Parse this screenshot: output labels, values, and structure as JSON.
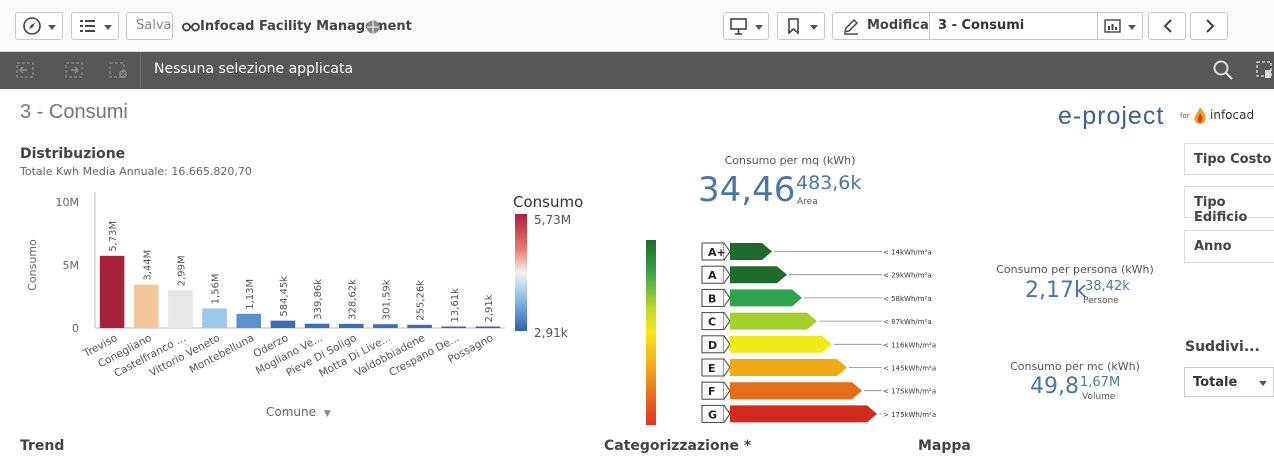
{
  "toolbar": {
    "save_label": "Salva",
    "app_title": "Infocad Facility Management",
    "edit_label": "Modifica",
    "sheet_selector": "3 - Consumi"
  },
  "selection_bar": {
    "message": "Nessuna selezione applicata"
  },
  "sheet": {
    "title": "3 - Consumi",
    "logo_text": "e-project",
    "logo_for": "for",
    "logo_brand": "infocad"
  },
  "distribuzione": {
    "title": "Distribuzione",
    "subtitle": "Totale Kwh Media Annuale: 16.665.820,70",
    "dimension_label": "Comune",
    "legend_title": "Consumo",
    "legend_max": "5,73M",
    "legend_min": "2,91k"
  },
  "chart_data": {
    "type": "bar",
    "categories": [
      "Treviso",
      "Conegliano",
      "Castelfranco ...",
      "Vittorio Veneto",
      "Montebelluna",
      "Oderzo",
      "Mogliano Ve...",
      "Pieve Di Soligo",
      "Motta Di Live...",
      "Valdobbiadene",
      "Crespano De...",
      "Possagno"
    ],
    "values": [
      5730000,
      3440000,
      2990000,
      1560000,
      1130000,
      584450,
      339860,
      328620,
      301590,
      255260,
      13610,
      2910
    ],
    "data_labels": [
      "5,73M",
      "3,44M",
      "2,99M",
      "1,56M",
      "1,13M",
      "584,45k",
      "339,86k",
      "328,62k",
      "301,59k",
      "255,26k",
      "13,61k",
      "2,91k"
    ],
    "colors": [
      "#a8223e",
      "#f4c79a",
      "#e6e6e6",
      "#9cc7ea",
      "#5b8fd0",
      "#3d6cb9",
      "#3d6cb9",
      "#3d6cb9",
      "#3d6cb9",
      "#3d6cb9",
      "#3461b0",
      "#3461b0"
    ],
    "ylabel": "Consumo",
    "xlabel": "Comune",
    "yticks": [
      "10M",
      "5M",
      "0"
    ],
    "ytick_values": [
      10000000,
      5000000,
      0
    ],
    "ylim": [
      0,
      10000000
    ],
    "grid": false,
    "legend_placement": "right"
  },
  "kpi_mq": {
    "label": "Consumo per mq (kWh)",
    "value": "34,46",
    "secondary": "483,6k",
    "secondary_label": "Area"
  },
  "kpi_persona": {
    "label": "Consumo per persona (kWh)",
    "value": "2,17k",
    "secondary": "38,42k",
    "secondary_label": "Persone"
  },
  "kpi_mc": {
    "label": "Consumo per mc (kWh)",
    "value": "49,8",
    "secondary": "1,67M",
    "secondary_label": "Volume"
  },
  "energy_classes": [
    {
      "label": "A+",
      "threshold": "< 14kWh/m²a",
      "color": "#1f6b2c"
    },
    {
      "label": "A",
      "threshold": "< 29kWh/m²a",
      "color": "#1f6b2c"
    },
    {
      "label": "B",
      "threshold": "< 58kWh/m²a",
      "color": "#2ea44a"
    },
    {
      "label": "C",
      "threshold": "< 87kWh/m²a",
      "color": "#a6cf2b"
    },
    {
      "label": "D",
      "threshold": "< 116kWh/m²a",
      "color": "#f0ea18"
    },
    {
      "label": "E",
      "threshold": "< 145kWh/m²a",
      "color": "#f3a916"
    },
    {
      "label": "F",
      "threshold": "< 175kWh/m²a",
      "color": "#e56d1a"
    },
    {
      "label": "G",
      "threshold": "> 175kWh/m²a",
      "color": "#d32a1e"
    }
  ],
  "filters": {
    "tipo_costo": "Tipo Costo",
    "tipo_edificio": "Tipo Edificio",
    "anno": "Anno",
    "suddivisione_title": "Suddivi...",
    "suddivisione_value": "Totale"
  },
  "bottom": {
    "trend": "Trend",
    "categorizzazione": "Categorizzazione *",
    "mappa": "Mappa"
  }
}
